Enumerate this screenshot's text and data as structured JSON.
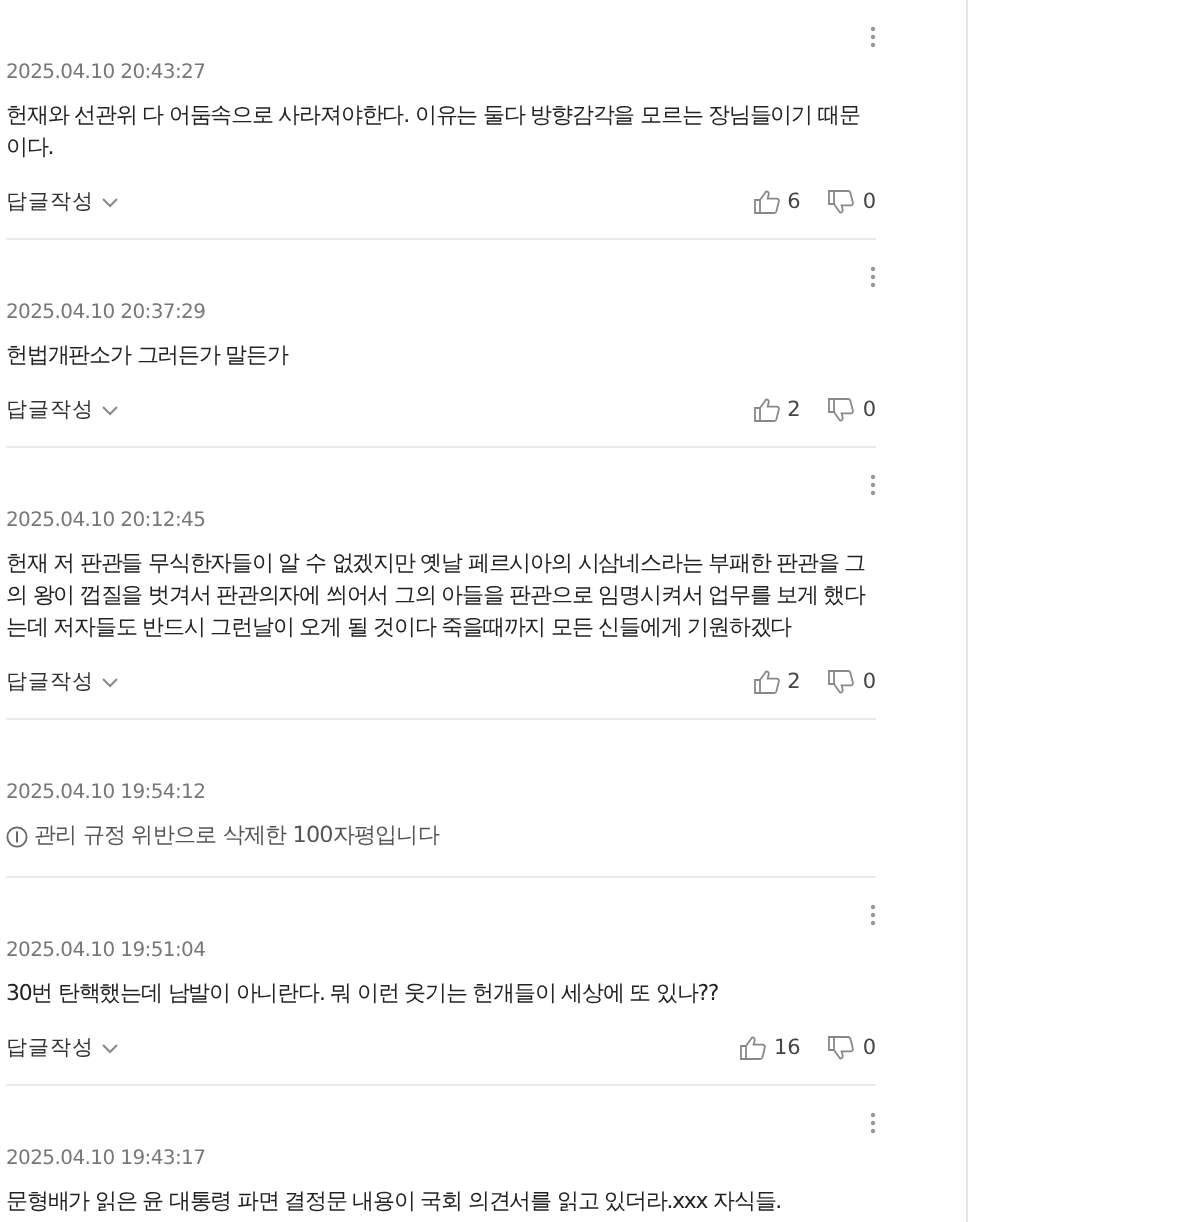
{
  "comments": [
    {
      "kind": "normal",
      "date": "2025.04.10 20:43:27",
      "text": "헌재와 선관위 다 어둠속으로 사라져야한다. 이유는 둘다 방향감각을 모르는 장님들이기 때문이다.",
      "reply_label": "답글작성",
      "likes": "6",
      "dislikes": "0"
    },
    {
      "kind": "normal",
      "date": "2025.04.10 20:37:29",
      "text": "헌법개판소가 그러든가 말든가",
      "reply_label": "답글작성",
      "likes": "2",
      "dislikes": "0"
    },
    {
      "kind": "normal",
      "date": "2025.04.10 20:12:45",
      "text": "헌재 저 판관들 무식한자들이 알 수 없겠지만 옛날 페르시아의 시삼네스라는 부패한 판관을 그의 왕이 껍질을 벗겨서 판관의자에 씌어서 그의 아들을 판관으로 임명시켜서 업무를 보게 했다는데 저자들도 반드시 그런날이 오게 될 것이다 죽을때까지 모든 신들에게 기원하겠다",
      "reply_label": "답글작성",
      "likes": "2",
      "dislikes": "0"
    },
    {
      "kind": "deleted",
      "date": "2025.04.10 19:54:12",
      "notice": "관리 규정 위반으로 삭제한 100자평입니다"
    },
    {
      "kind": "normal",
      "date": "2025.04.10 19:51:04",
      "text": "30번 탄핵했는데 남발이 아니란다. 뭐 이런 웃기는 헌개들이 세상에 또 있나??",
      "reply_label": "답글작성",
      "likes": "16",
      "dislikes": "0"
    },
    {
      "kind": "cut",
      "date": "2025.04.10 19:43:17",
      "text": "문형배가 읽은 윤 대통령 파면 결정문 내용이 국회 의견서를 읽고 있더라.xxx 자식들."
    }
  ]
}
